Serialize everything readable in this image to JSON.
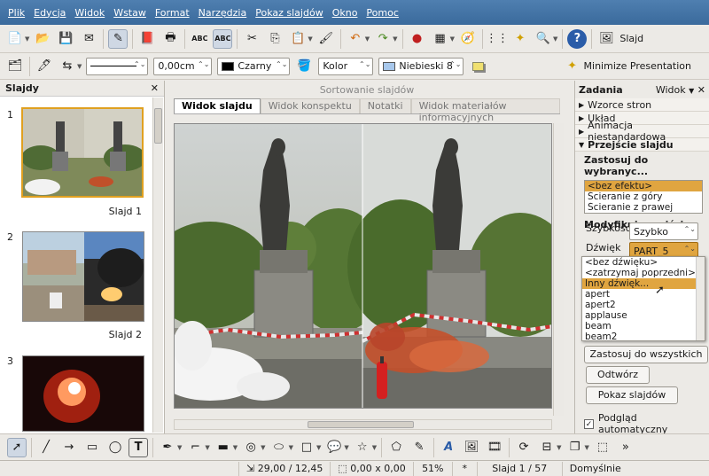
{
  "menu": [
    "Plik",
    "Edycja",
    "Widok",
    "Wstaw",
    "Format",
    "Narzędzia",
    "Pokaz slajdów",
    "Okno",
    "Pomoc"
  ],
  "toolbar1": {
    "slide_label": "Slajd"
  },
  "toolbar2": {
    "line_width": "0,00cm",
    "line_color": "Czarny",
    "area_style": "Kolor",
    "area_color": "Niebieski 8",
    "minimize_label": "Minimize Presentation"
  },
  "slides_panel": {
    "title": "Slajdy",
    "items": [
      {
        "num": "1",
        "label": "Slajd 1"
      },
      {
        "num": "2",
        "label": "Slajd 2"
      },
      {
        "num": "3",
        "label": ""
      }
    ]
  },
  "center": {
    "sort_tab": "Sortowanie slajdów",
    "tabs": [
      "Widok slajdu",
      "Widok konspektu",
      "Notatki",
      "Widok materiałów informacyjnych"
    ],
    "slide_text_left": "",
    "slide_text_right": ""
  },
  "tasks": {
    "title": "Zadania",
    "view_label": "Widok",
    "sections": [
      "Wzorce stron",
      "Układ",
      "Animacja niestandardowa",
      "Przejście slajdu"
    ],
    "apply_label": "Zastosuj do wybranyc...",
    "effects": [
      "<bez efektu>",
      "Ścieranie z góry",
      "Ścieranie z prawej"
    ],
    "modify_label": "Modyfikuj przejście",
    "speed_label": "Szybkość",
    "speed_value": "Szybko",
    "sound_label": "Dźwięk",
    "sound_value": "PART_5",
    "sound_options": [
      "<bez dźwięku>",
      "<zatrzymaj poprzedni>",
      "Inny dźwięk...",
      "apert",
      "apert2",
      "applause",
      "beam",
      "beam2"
    ],
    "apply_all": "Zastosuj do wszystkich",
    "play": "Odtwórz",
    "slideshow": "Pokaz slajdów",
    "autopreview": "Podgląd automatyczny"
  },
  "status": {
    "position": "29,00 / 12,45",
    "size": "0,00 x 0,00",
    "zoom": "51%",
    "modified": "*",
    "slide": "Slajd 1 / 57",
    "layout": "Domyślnie"
  },
  "colors": {
    "accent": "#e0a540",
    "menubar": "#3a6a9c"
  }
}
